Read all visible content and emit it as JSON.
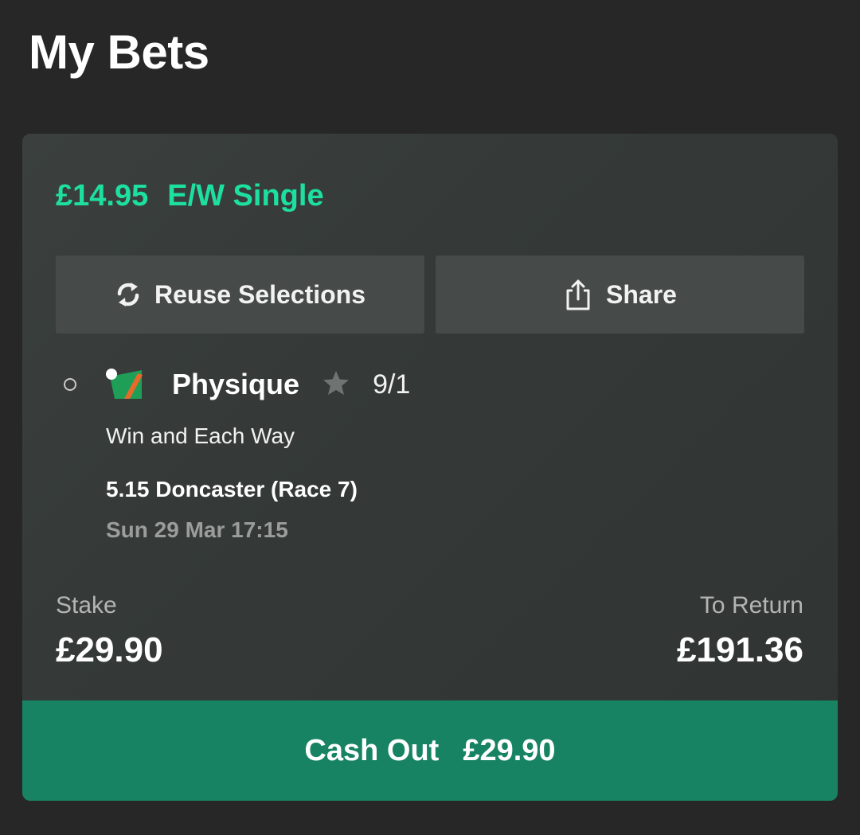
{
  "header": {
    "title": "My Bets"
  },
  "bet": {
    "unit_stake": "£14.95",
    "bet_type": "E/W Single",
    "reuse_label": "Reuse Selections",
    "share_label": "Share",
    "selection": {
      "runner": "Physique",
      "odds": "9/1",
      "market": "Win and Each Way",
      "race": "5.15 Doncaster (Race 7)",
      "datetime": "Sun 29 Mar 17:15"
    },
    "stake_label": "Stake",
    "stake_value": "£29.90",
    "return_label": "To Return",
    "return_value": "£191.36",
    "cashout_label": "Cash Out",
    "cashout_value": "£29.90"
  },
  "colors": {
    "accent": "#1de0a0",
    "cashout": "#178362",
    "background": "#272727",
    "card": "#363b39"
  }
}
